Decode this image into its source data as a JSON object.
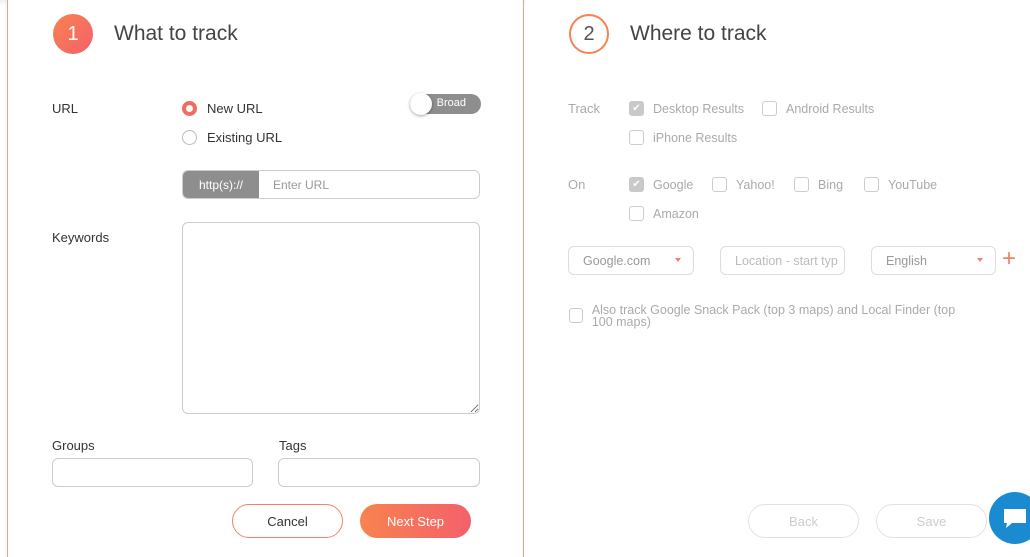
{
  "step1": {
    "number": "1",
    "title": "What to track",
    "url_label": "URL",
    "radio_new": "New URL",
    "radio_existing": "Existing URL",
    "toggle_label": "Broad",
    "url_prefix": "http(s)://",
    "url_placeholder": "Enter URL",
    "keywords_label": "Keywords",
    "groups_label": "Groups",
    "tags_label": "Tags",
    "cancel_label": "Cancel",
    "next_label": "Next Step"
  },
  "step2": {
    "number": "2",
    "title": "Where to track",
    "track_label": "Track",
    "device_options": [
      {
        "label": "Desktop Results",
        "checked": true
      },
      {
        "label": "Android Results",
        "checked": false
      },
      {
        "label": "iPhone Results",
        "checked": false
      }
    ],
    "on_label": "On",
    "engine_options": [
      {
        "label": "Google",
        "checked": true
      },
      {
        "label": "Yahoo!",
        "checked": false
      },
      {
        "label": "Bing",
        "checked": false
      },
      {
        "label": "YouTube",
        "checked": false
      },
      {
        "label": "Amazon",
        "checked": false
      }
    ],
    "domain_select": "Google.com",
    "location_placeholder": "Location - start typ",
    "language_select": "English",
    "snack_pack_label": "Also track Google Snack Pack (top 3 maps) and Local Finder (top 100 maps)",
    "back_label": "Back",
    "save_label": "Save"
  },
  "colors": {
    "accent_start": "#f7834f",
    "accent_end": "#f4606b",
    "chat": "#1a8bd0"
  }
}
